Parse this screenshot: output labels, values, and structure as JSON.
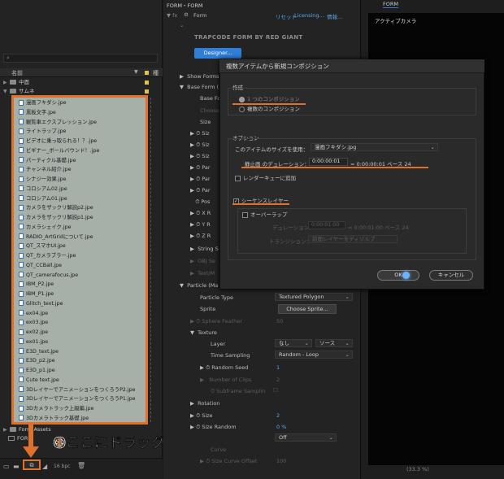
{
  "effects_panel": {
    "header": "FORM・FORM",
    "effect_name": "Form",
    "reset": "リセット",
    "licensing": "Licensing...",
    "info": "情報...",
    "brand": "TRAPCODE FORM BY RED GIANT",
    "designer": "Designer...",
    "rows": {
      "show_forms": "Show Forms",
      "base_form": "Base Form (",
      "base_form_sub": "Base Fo",
      "choose": "Choose",
      "size": "Size",
      "siz1": "Siz",
      "siz2": "Siz",
      "siz3": "Siz",
      "par1": "Par",
      "par2": "Par",
      "par3": "Par",
      "pos": "Pos",
      "x_r": "X R",
      "y_r": "Y R",
      "z_r": "Z R",
      "string_s": "String S",
      "obj_se": "OBJ Se",
      "text_m": "Text/M",
      "particle": "Particle (Ma",
      "particle_type": "Particle Type",
      "particle_type_value": "Textured Polygon",
      "sprite": "Sprite",
      "choose_sprite": "Choose Sprite...",
      "sphere_feather": "Sphere Feather",
      "sphere_feather_value": "50",
      "texture": "Texture",
      "layer": "Layer",
      "layer_value": "なし",
      "layer_source": "ソース",
      "time_sampling": "Time Sampling",
      "time_sampling_value": "Random - Loop",
      "random_seed": "Random Seed",
      "random_seed_value": "1",
      "number_of_clips": "Number of Clips",
      "number_of_clips_value": "2",
      "subframe": "Subframe Samplin",
      "rotation": "Rotation",
      "size2": "Size",
      "size2_value": "2",
      "size_random": "Size Random",
      "size_random_value": "0 %",
      "off_value": "Off",
      "curve": "Curve",
      "size_curve_offset": "Size Curve Offset",
      "size_curve_offset_value": "100"
    }
  },
  "viewer": {
    "tab": "FORM",
    "camera": "アクティブカメラ",
    "zoom": "(33.3 %)"
  },
  "dialog": {
    "title": "複数アイテムから新規コンポジション",
    "create_label": "作成",
    "option_single": "1 つのコンポジション",
    "option_multiple": "複数のコンポジション",
    "options_label": "オプション",
    "use_dimensions_label": "このアイテムのサイズを使用：",
    "use_dimensions_value": "漫画フキダシ.jpg",
    "still_duration_label": "静止画 のデュレーション：",
    "still_duration_value": "0:00:00:01",
    "still_duration_info": "= 0:00:00:01  ベース 24",
    "render_queue": "レンダーキューに追加",
    "sequence_layers": "シーケンスレイヤー",
    "overlap": "オーバーラップ",
    "overlap_duration_label": "デュレーション：",
    "overlap_duration_value": "0:00:01:00",
    "overlap_duration_info": "= 0:00:01:00  ベース 24",
    "transition_label": "トランジション：",
    "transition_value": "前面レイヤーをディゾルブ",
    "ok": "OK",
    "cancel": "キャンセル"
  },
  "project_panel": {
    "search_icon": "magnifier-icon",
    "column_name": "名前",
    "column_type": "種",
    "folder_above": "中面",
    "folder_open": "サムネ",
    "files": [
      "漫画フキダシ.jpe",
      "黒板文字.jpe",
      "観覧車エクスプレッション.jpe",
      "ライトラップ.jpe",
      "ビデオに乗っ取られる！？.jpe",
      "ビギナー_ボールバウンド！.jpe",
      "パーティクル基礎.jpe",
      "チャンネル紹介.jpe",
      "シナジー効果.jpe",
      "コロシアム02.jpe",
      "コロシアム01.jpe",
      "カメラをザックリ解説p2.jpe",
      "カメラをザックリ解説p1.jpe",
      "カメラシェイク.jpe",
      "RADIO_ArtGridについて.jpe",
      "QT_スマホUI.jpe",
      "QT_カメラブラー.jpe",
      "QT_CCBall.jpe",
      "QT_camerafocus.jpe",
      "IBM_P2.jpe",
      "IBM_P1.jpe",
      "Glitch_text.jpe",
      "ex04.jpe",
      "ex03.jpe",
      "ex02.jpe",
      "ex01.jpe",
      "E3D_text.jpe",
      "E3D_p2.jpe",
      "E3D_p1.jpe",
      "Cute text.jpe",
      "3DレイヤーでアニメーションをつくろうP2.jpe",
      "3DレイヤーでアニメーションをつくろうP1.jpe",
      "3Dカメラトラック上級編.jpe",
      "3Dカメラトラック基礎.jpe"
    ],
    "folder_form_assets": "Form Assets",
    "comp_form": "FORM",
    "bpc": "16 bpc"
  },
  "annotation": {
    "number": "①",
    "text": "ここにドラッグ"
  },
  "colors": {
    "highlight": "#e0712d",
    "accent_blue": "#2f7fd8"
  }
}
